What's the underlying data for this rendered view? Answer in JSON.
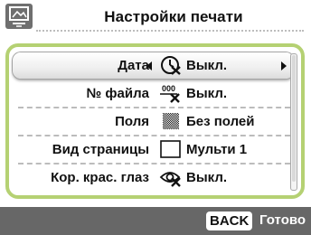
{
  "header": {
    "icon": "print-settings-icon",
    "title": "Настройки печати"
  },
  "settings": [
    {
      "label": "Дата",
      "value": "Выкл.",
      "icon": "date-off-icon",
      "selected": true
    },
    {
      "label": "№ файла",
      "value": "Выкл.",
      "icon": "file-number-off-icon",
      "icon_text": "000"
    },
    {
      "label": "Поля",
      "value": "Без полей",
      "icon": "borderless-icon"
    },
    {
      "label": "Вид страницы",
      "value": "Мульти 1",
      "icon": "layout-icon"
    },
    {
      "label": "Кор. крас. глаз",
      "value": "Выкл.",
      "icon": "red-eye-off-icon"
    }
  ],
  "footer": {
    "back_key": "BACK",
    "back_action": "Готово"
  },
  "colors": {
    "panel_border": "#b5d173",
    "footer_bg": "#676767",
    "header_icon_bg": "#6f6f6f"
  }
}
